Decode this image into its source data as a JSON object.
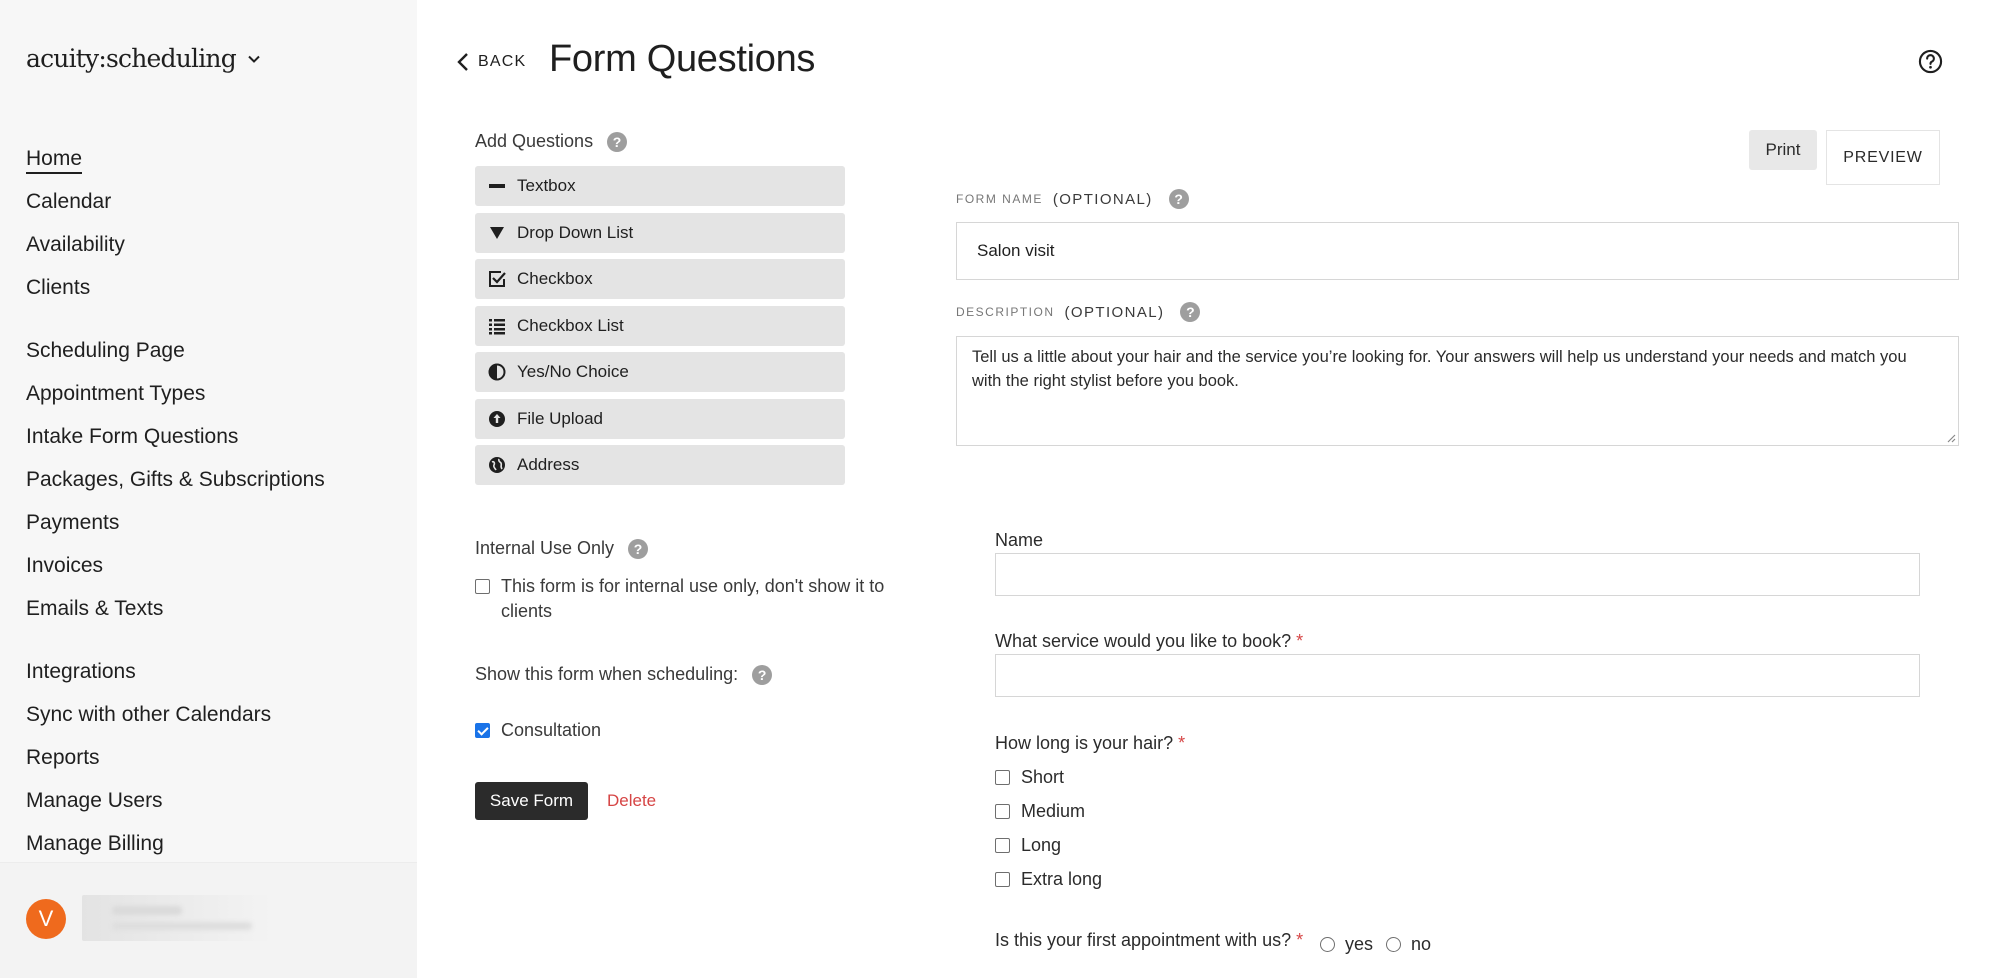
{
  "sidebar": {
    "logo": "acuity:scheduling",
    "groups": [
      [
        {
          "label": "Home",
          "active": true
        },
        {
          "label": "Calendar"
        },
        {
          "label": "Availability"
        },
        {
          "label": "Clients"
        }
      ],
      [
        {
          "label": "Scheduling Page"
        },
        {
          "label": "Appointment Types"
        },
        {
          "label": "Intake Form Questions"
        },
        {
          "label": "Packages, Gifts & Subscriptions"
        },
        {
          "label": "Payments"
        },
        {
          "label": "Invoices"
        },
        {
          "label": "Emails & Texts"
        }
      ],
      [
        {
          "label": "Integrations"
        },
        {
          "label": "Sync with other Calendars"
        },
        {
          "label": "Reports"
        },
        {
          "label": "Manage Users"
        },
        {
          "label": "Manage Billing"
        }
      ]
    ],
    "user": {
      "initial": "V",
      "avatar_color": "#ef6a1d"
    }
  },
  "header": {
    "back_label": "BACK",
    "title": "Form Questions"
  },
  "add_questions": {
    "label": "Add Questions",
    "buttons": [
      {
        "icon": "textbox-icon",
        "label": "Textbox"
      },
      {
        "icon": "dropdown-icon",
        "label": "Drop Down List"
      },
      {
        "icon": "checkbox-icon",
        "label": "Checkbox"
      },
      {
        "icon": "list-icon",
        "label": "Checkbox List"
      },
      {
        "icon": "half-circle-icon",
        "label": "Yes/No Choice"
      },
      {
        "icon": "upload-icon",
        "label": "File Upload"
      },
      {
        "icon": "globe-icon",
        "label": "Address"
      }
    ]
  },
  "internal": {
    "label": "Internal Use Only",
    "checkbox_label": "This form is for internal use only, don't show it to clients",
    "checked": false
  },
  "show_when": {
    "label": "Show this form when scheduling:",
    "options": [
      {
        "label": "Consultation",
        "checked": true
      }
    ]
  },
  "actions": {
    "save_label": "Save Form",
    "delete_label": "Delete"
  },
  "builder": {
    "print_label": "Print",
    "preview_label": "PREVIEW",
    "form_name_label": "FORM NAME",
    "optional_label": "(OPTIONAL)",
    "form_name_value": "Salon visit",
    "description_label": "DESCRIPTION",
    "description_value": "Tell us a little about your hair and the service you’re looking for. Your answers will help us understand your needs and match you with the right stylist before you book.",
    "preview": {
      "name_label": "Name",
      "service_label": "What service would you like to book?",
      "hair_label": "How long is your hair?",
      "hair_options": [
        "Short",
        "Medium",
        "Long",
        "Extra long"
      ],
      "first_appt_label": "Is this your first appointment with us?",
      "yes_label": "yes",
      "no_label": "no",
      "required_mark": "*"
    }
  },
  "colors": {
    "accent_dark": "#2b2b2b",
    "delete_red": "#d64545",
    "checkbox_blue": "#1a73e8"
  }
}
